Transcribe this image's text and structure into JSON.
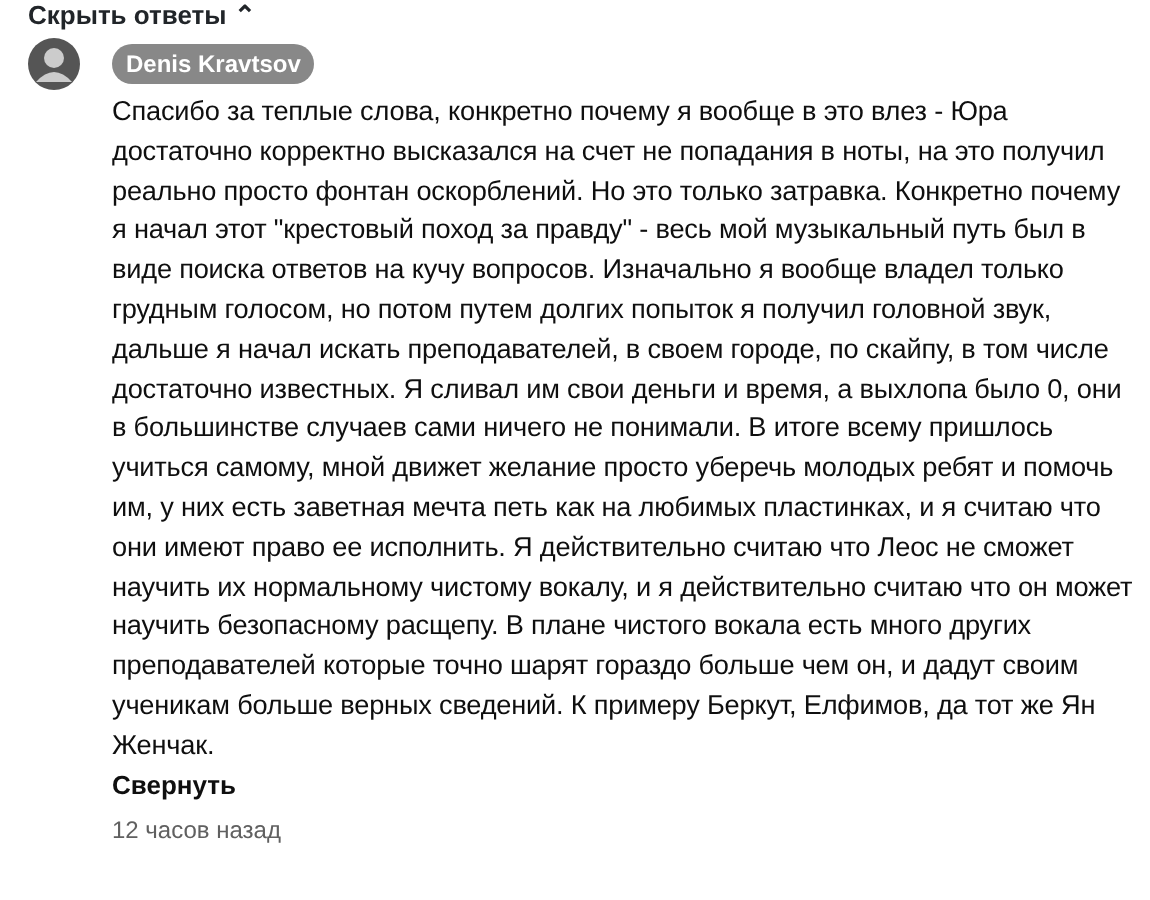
{
  "hide_replies": {
    "label": "Скрыть ответы",
    "arrow": "⌃"
  },
  "comment": {
    "author": "Denis Kravtsov",
    "text": "Спасибо за теплые слова, конкретно почему я вообще в это влез - Юра достаточно корректно высказался на счет не попадания в ноты, на это получил реально просто фонтан оскорблений. Но это только затравка. Конкретно почему я начал этот \"крестовый поход за правду\" - весь мой музыкальный путь был в виде поиска ответов на кучу вопросов. Изначально я вообще владел только грудным голосом, но потом путем долгих попыток я получил головной звук, дальше я начал искать преподавателей, в своем городе, по скайпу, в том числе достаточно известных. Я сливал им свои деньги и время, а выхлопа было 0, они в большинстве случаев сами ничего не понимали. В итоге всему пришлось учиться самому, мной движет желание просто уберечь молодых ребят и помочь им, у них есть заветная мечта петь как на любимых пластинках, и я считаю что они имеют право ее исполнить. Я действительно считаю что Леос не сможет научить их нормальному чистому вокалу, и я действительно считаю что он может научить безопасному расщепу. В плане чистого вокала есть много других преподавателей которые точно шарят гораздо больше чем он, и дадут своим ученикам больше верных сведений. К примеру Беркут, Елфимов, да тот же Ян Женчак.",
    "collapse_label": "Свернуть",
    "time": "12 часов назад"
  }
}
